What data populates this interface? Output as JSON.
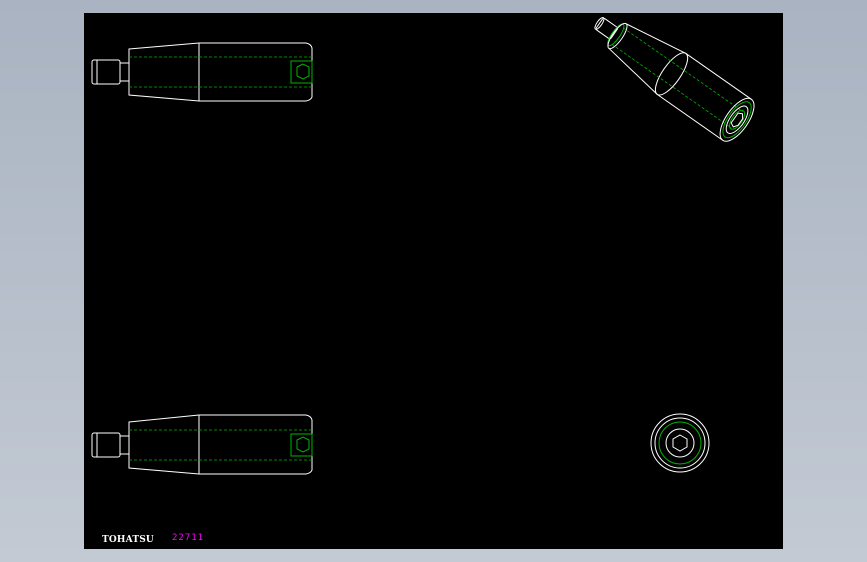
{
  "title_block": {
    "brand": "TOHATSU",
    "code": "22711"
  },
  "colors": {
    "viewport_background": "#000000",
    "outline": "#ffffff",
    "hidden_lines": "#00b400",
    "code_text": "#ff00ff",
    "window_background": "#b6bfcb"
  }
}
